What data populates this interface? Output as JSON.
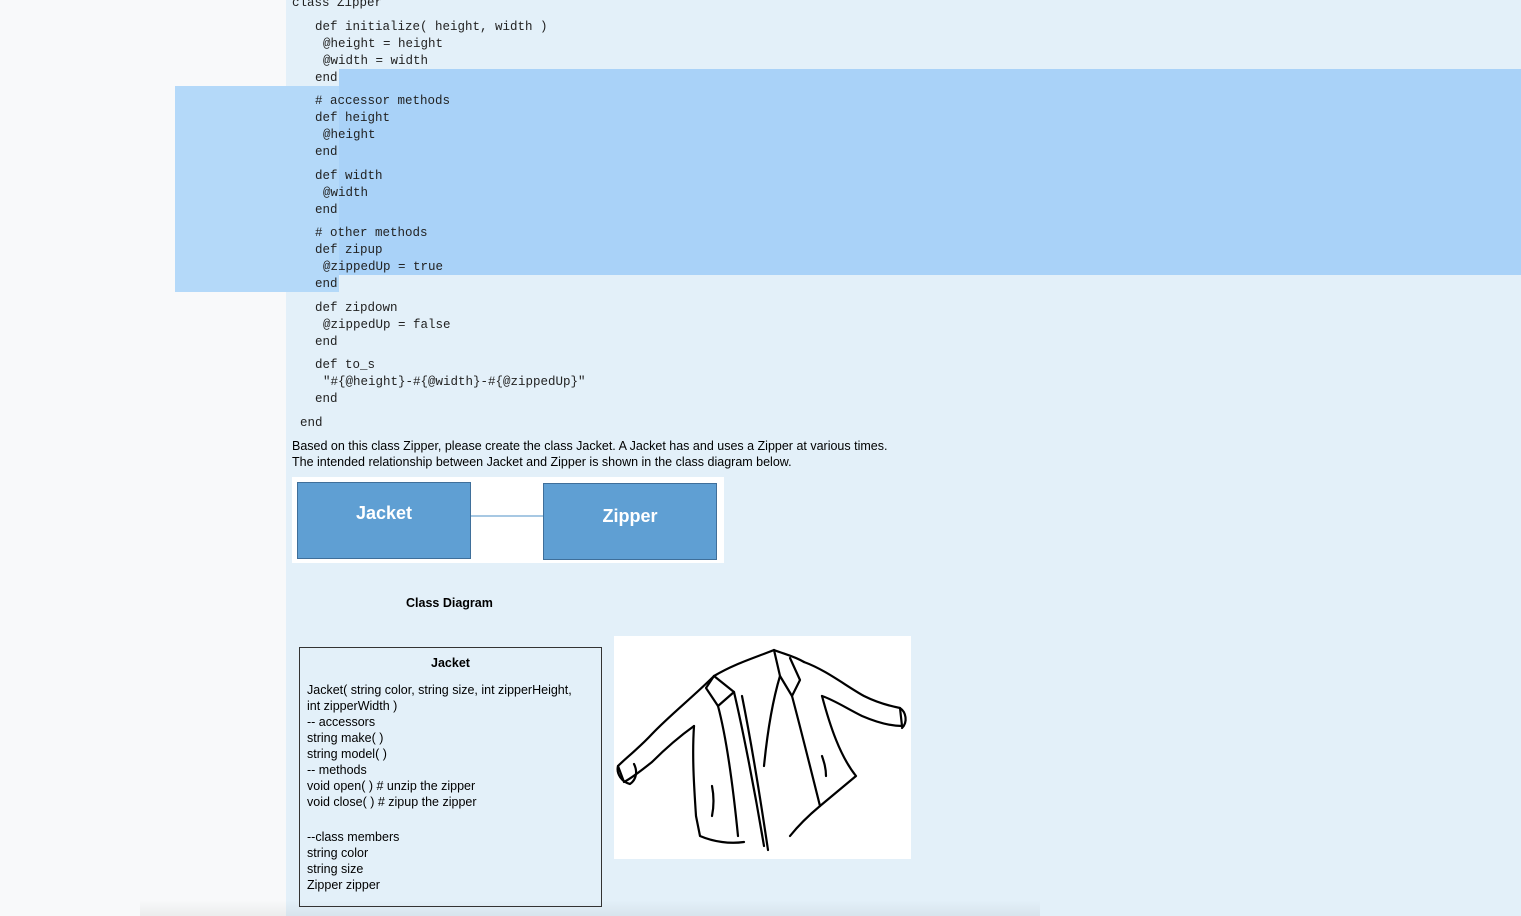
{
  "code": {
    "lines": [
      "class Zipper",
      "def initialize( height, width )",
      "@height = height",
      "@width = width",
      "end",
      "# accessor methods",
      "def height",
      "@height",
      "end",
      "def width",
      "@width",
      "end",
      "# other methods",
      "def zipup",
      "@zippedUp = true",
      "end",
      "def zipdown",
      "@zippedUp = false",
      "end",
      "def to_s",
      "\"#{@height}-#{@width}-#{@zippedUp}\"",
      "end",
      "end"
    ]
  },
  "prose": {
    "line1": "Based on this class Zipper, please create the class Jacket.  A Jacket has and uses a Zipper at various times.",
    "line2": "The intended relationship between Jacket and Zipper is shown in the class diagram below."
  },
  "diagram": {
    "left_class": "Jacket",
    "right_class": "Zipper",
    "caption": "Class Diagram",
    "box_color": "#5f9fd3"
  },
  "uml": {
    "title": "Jacket",
    "lines": [
      "Jacket( string color, string size, int zipperHeight,",
      "int zipperWidth )",
      "-- accessors",
      "string make( )",
      "string model( )",
      "-- methods",
      "void open( ) # unzip the zipper",
      "void close( ) # zipup the zipper",
      "--class members",
      "string color",
      "string size",
      "Zipper zipper"
    ]
  },
  "image": {
    "icon": "jacket-sketch-icon"
  },
  "colors": {
    "page_background": "#e3f0f9",
    "selection": "#a9d2f8"
  }
}
